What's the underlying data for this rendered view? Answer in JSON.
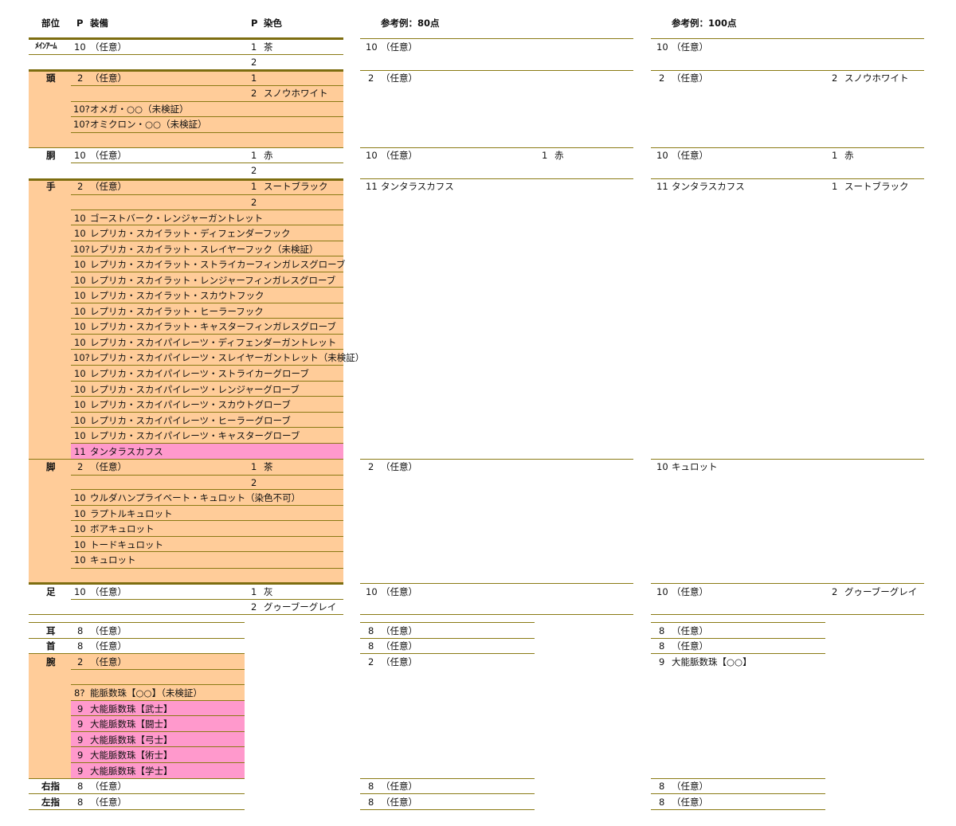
{
  "colors": {
    "peach": "#ffcc99",
    "pink": "#ff99cc",
    "rule": "#8a7a14"
  },
  "headers": {
    "part": "部位",
    "p1": "P",
    "equip": "装備",
    "p2": "P",
    "dye": "染色",
    "ex80": "参考例：80点",
    "ex100": "参考例：100点"
  },
  "main": {
    "mainarm": {
      "label": "ﾒｲﾝｱｰﾑ",
      "r1": {
        "p": "10",
        "name": "（任意）",
        "dp": "1",
        "dye": "茶"
      },
      "r2": {
        "dp": "2"
      }
    },
    "head": {
      "label": "頭",
      "r1": {
        "p": "2",
        "name": "（任意）",
        "dp": "1"
      },
      "r2": {
        "dp": "2",
        "dye": "スノウホワイト"
      },
      "r3": {
        "p": "10?",
        "name": "オメガ・○○（未検証）"
      },
      "r4": {
        "p": "10?",
        "name": "オミクロン・○○（未検証）"
      }
    },
    "body": {
      "label": "胴",
      "r1": {
        "p": "10",
        "name": "（任意）",
        "dp": "1",
        "dye": "赤"
      },
      "r2": {
        "dp": "2"
      }
    },
    "hands": {
      "label": "手",
      "r1": {
        "p": "2",
        "name": "（任意）",
        "dp": "1",
        "dye": "スートブラック"
      },
      "r2": {
        "dp": "2"
      },
      "list": [
        {
          "p": "10",
          "name": "ゴーストバーク・レンジャーガントレット"
        },
        {
          "p": "10",
          "name": "レプリカ・スカイラット・ディフェンダーフック"
        },
        {
          "p": "10?",
          "name": "レプリカ・スカイラット・スレイヤーフック（未検証）"
        },
        {
          "p": "10",
          "name": "レプリカ・スカイラット・ストライカーフィンガレスグローブ"
        },
        {
          "p": "10",
          "name": "レプリカ・スカイラット・レンジャーフィンガレスグローブ"
        },
        {
          "p": "10",
          "name": "レプリカ・スカイラット・スカウトフック"
        },
        {
          "p": "10",
          "name": "レプリカ・スカイラット・ヒーラーフック"
        },
        {
          "p": "10",
          "name": "レプリカ・スカイラット・キャスターフィンガレスグローブ"
        },
        {
          "p": "10",
          "name": "レプリカ・スカイパイレーツ・ディフェンダーガントレット"
        },
        {
          "p": "10?",
          "name": "レプリカ・スカイパイレーツ・スレイヤーガントレット（未検証）"
        },
        {
          "p": "10",
          "name": "レプリカ・スカイパイレーツ・ストライカーグローブ"
        },
        {
          "p": "10",
          "name": "レプリカ・スカイパイレーツ・レンジャーグローブ"
        },
        {
          "p": "10",
          "name": "レプリカ・スカイパイレーツ・スカウトグローブ"
        },
        {
          "p": "10",
          "name": "レプリカ・スカイパイレーツ・ヒーラーグローブ"
        },
        {
          "p": "10",
          "name": "レプリカ・スカイパイレーツ・キャスターグローブ"
        },
        {
          "p": "11",
          "name": "タンタラスカフス"
        }
      ]
    },
    "legs": {
      "label": "脚",
      "r1": {
        "p": "2",
        "name": "（任意）",
        "dp": "1",
        "dye": "茶"
      },
      "r2": {
        "dp": "2"
      },
      "list": [
        {
          "p": "10",
          "name": "ウルダハンプライベート・キュロット（染色不可）"
        },
        {
          "p": "10",
          "name": "ラプトルキュロット"
        },
        {
          "p": "10",
          "name": "ボアキュロット"
        },
        {
          "p": "10",
          "name": "トードキュロット"
        },
        {
          "p": "10",
          "name": "キュロット"
        }
      ]
    },
    "feet": {
      "label": "足",
      "r1": {
        "p": "10",
        "name": "（任意）",
        "dp": "1",
        "dye": "灰"
      },
      "r2": {
        "dp": "2",
        "dye": "グゥーブーグレイ"
      }
    }
  },
  "acc": {
    "ears": {
      "label": "耳",
      "p": "8",
      "name": "（任意）"
    },
    "neck": {
      "label": "首",
      "p": "8",
      "name": "（任意）"
    },
    "wrist": {
      "label": "腕",
      "r1": {
        "p": "2",
        "name": "（任意）"
      },
      "list": [
        {
          "p": "8?",
          "name": "能脈数珠【○○】（未検証）"
        },
        {
          "p": "9",
          "name": "大能脈数珠【武士】"
        },
        {
          "p": "9",
          "name": "大能脈数珠【闘士】"
        },
        {
          "p": "9",
          "name": "大能脈数珠【弓士】"
        },
        {
          "p": "9",
          "name": "大能脈数珠【術士】"
        },
        {
          "p": "9",
          "name": "大能脈数珠【学士】"
        }
      ]
    },
    "rring": {
      "label": "右指",
      "p": "8",
      "name": "（任意）"
    },
    "lring": {
      "label": "左指",
      "p": "8",
      "name": "（任意）"
    }
  },
  "ex80": {
    "mainarm": {
      "p": "10",
      "name": "（任意）"
    },
    "head": {
      "p": "2",
      "name": "（任意）"
    },
    "body": {
      "p": "10",
      "name": "（任意）",
      "dp": "1",
      "dye": "赤"
    },
    "hands": {
      "p": "11",
      "name": "タンタラスカフス"
    },
    "legs": {
      "p": "2",
      "name": "（任意）"
    },
    "feet": {
      "p": "10",
      "name": "（任意）"
    },
    "ears": {
      "p": "8",
      "name": "（任意）"
    },
    "neck": {
      "p": "8",
      "name": "（任意）"
    },
    "wrist": {
      "p": "2",
      "name": "（任意）"
    },
    "rring": {
      "p": "8",
      "name": "（任意）"
    },
    "lring": {
      "p": "8",
      "name": "（任意）"
    }
  },
  "ex100": {
    "mainarm": {
      "p": "10",
      "name": "（任意）"
    },
    "head": {
      "p": "2",
      "name": "（任意）",
      "dp": "2",
      "dye": "スノウホワイト"
    },
    "body": {
      "p": "10",
      "name": "（任意）",
      "dp": "1",
      "dye": "赤"
    },
    "hands": {
      "p": "11",
      "name": "タンタラスカフス",
      "dp": "1",
      "dye": "スートブラック"
    },
    "legs": {
      "p": "10",
      "name": "キュロット"
    },
    "feet": {
      "p": "10",
      "name": "（任意）",
      "dp": "2",
      "dye": "グゥーブーグレイ"
    },
    "ears": {
      "p": "8",
      "name": "（任意）"
    },
    "neck": {
      "p": "8",
      "name": "（任意）"
    },
    "wrist": {
      "p": "9",
      "name": "大能脈数珠【○○】"
    },
    "rring": {
      "p": "8",
      "name": "（任意）"
    },
    "lring": {
      "p": "8",
      "name": "（任意）"
    }
  }
}
